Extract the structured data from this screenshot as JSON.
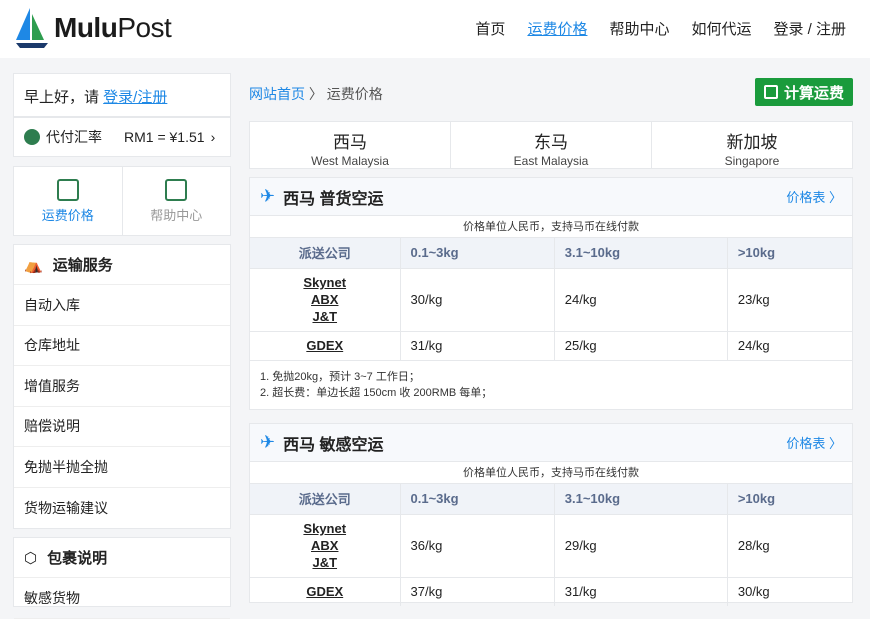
{
  "brand": {
    "bold": "Mulu",
    "light": "Post"
  },
  "nav": [
    {
      "label": "首页",
      "active": false
    },
    {
      "label": "运费价格",
      "active": true
    },
    {
      "label": "帮助中心",
      "active": false
    },
    {
      "label": "如何代运",
      "active": false
    },
    {
      "label": "登录 / 注册",
      "active": false
    }
  ],
  "greeting": {
    "prefix": "早上好，请 ",
    "link": "登录/注册"
  },
  "rate": {
    "label": "代付汇率",
    "value": "RM1 = ¥1.51",
    "chevron": "›"
  },
  "quick": [
    {
      "label": "运费价格"
    },
    {
      "label": "帮助中心"
    }
  ],
  "menu": {
    "title": "运输服务",
    "items": [
      "自动入库",
      "仓库地址",
      "增值服务",
      "赔偿说明",
      "免抛半抛全抛",
      "货物运输建议"
    ]
  },
  "menu2": {
    "title": "包裹说明",
    "items": [
      "敏感货物"
    ]
  },
  "breadcrumb": {
    "home": "网站首页",
    "sep": "〉",
    "current": "运费价格"
  },
  "calc_label": "计算运费",
  "regions": [
    {
      "zh": "西马",
      "en": "West Malaysia"
    },
    {
      "zh": "东马",
      "en": "East Malaysia"
    },
    {
      "zh": "新加坡",
      "en": "Singapore"
    }
  ],
  "sections": [
    {
      "title": "西马 普货空运",
      "more": "价格表 〉",
      "note": "价格单位人民币，支持马币在线付款",
      "headers": [
        "派送公司",
        "0.1~3kg",
        "3.1~10kg",
        ">10kg"
      ],
      "rows": [
        {
          "carriers": [
            "Skynet",
            "ABX",
            "J&T"
          ],
          "prices": [
            "30/kg",
            "24/kg",
            "23/kg"
          ]
        },
        {
          "carriers": [
            "GDEX"
          ],
          "prices": [
            "31/kg",
            "25/kg",
            "24/kg"
          ]
        }
      ],
      "footnotes": [
        "1. 免抛20kg，预计 3~7 工作日；",
        "2. 超长费：单边长超 150cm 收 200RMB 每单；"
      ]
    },
    {
      "title": "西马 敏感空运",
      "more": "价格表 〉",
      "note": "价格单位人民币，支持马币在线付款",
      "headers": [
        "派送公司",
        "0.1~3kg",
        "3.1~10kg",
        ">10kg"
      ],
      "rows": [
        {
          "carriers": [
            "Skynet",
            "ABX",
            "J&T"
          ],
          "prices": [
            "36/kg",
            "29/kg",
            "28/kg"
          ]
        },
        {
          "carriers": [
            "GDEX"
          ],
          "prices": [
            "37/kg",
            "31/kg",
            "30/kg"
          ]
        }
      ],
      "footnotes": []
    }
  ],
  "colors": {
    "accent": "#1e88e5",
    "green": "#1a9b3c"
  }
}
